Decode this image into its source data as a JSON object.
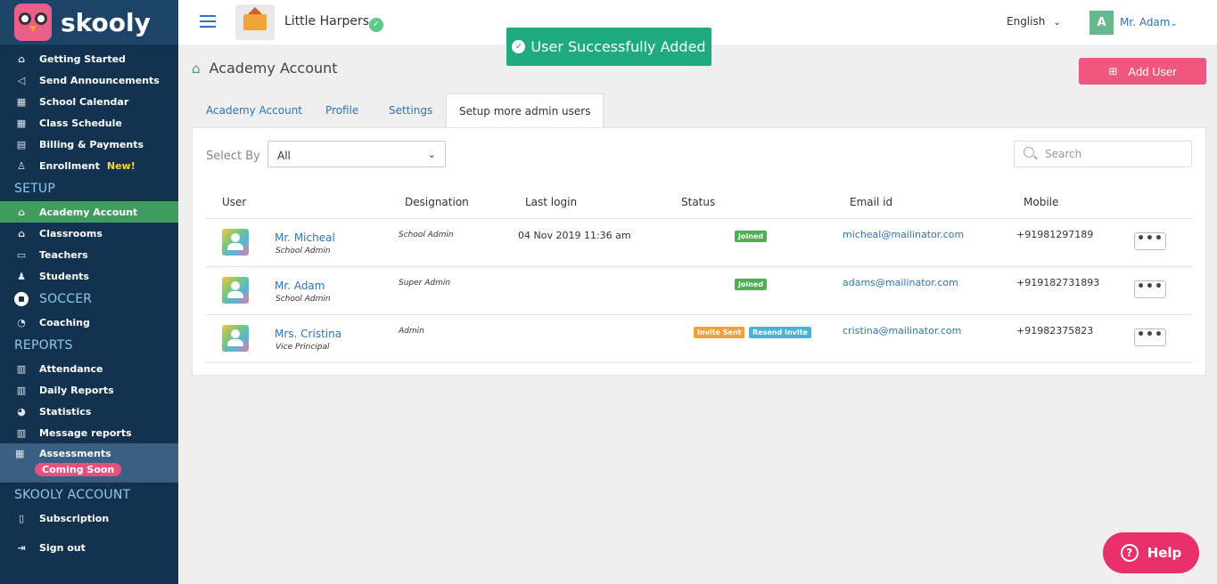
{
  "brand": {
    "name": "skooly"
  },
  "sidebar": {
    "main": [
      {
        "label": "Getting Started",
        "icon": "home-icon"
      },
      {
        "label": "Send Announcements",
        "icon": "megaphone-icon"
      },
      {
        "label": "School Calendar",
        "icon": "calendar-icon"
      },
      {
        "label": "Class Schedule",
        "icon": "schedule-icon"
      },
      {
        "label": "Billing & Payments",
        "icon": "billing-icon"
      },
      {
        "label": "Enrollment",
        "icon": "enrollment-icon",
        "badge": "New!"
      }
    ],
    "setup_title": "SETUP",
    "setup": [
      {
        "label": "Academy Account",
        "icon": "academy-icon",
        "active": true
      },
      {
        "label": "Classrooms",
        "icon": "classroom-icon"
      },
      {
        "label": "Teachers",
        "icon": "teacher-icon"
      },
      {
        "label": "Students",
        "icon": "student-icon"
      }
    ],
    "soccer_title": "SOCCER",
    "soccer": [
      {
        "label": "Coaching",
        "icon": "whistle-icon"
      }
    ],
    "reports_title": "REPORTS",
    "reports": [
      {
        "label": "Attendance",
        "icon": "attendance-icon"
      },
      {
        "label": "Daily Reports",
        "icon": "daily-report-icon"
      },
      {
        "label": "Statistics",
        "icon": "pie-chart-icon"
      },
      {
        "label": "Message reports",
        "icon": "message-report-icon"
      }
    ],
    "assessments": {
      "label": "Assessments",
      "badge": "Coming Soon"
    },
    "account_title": "SKOOLY ACCOUNT",
    "subscription": "Subscription",
    "signout": "Sign out"
  },
  "topbar": {
    "school_name": "Little Harpers",
    "language": "English",
    "user_initial": "A",
    "user_name": "Mr. Adam"
  },
  "toast": "User Successfully Added",
  "page": {
    "title": "Academy Account",
    "add_user": "Add User",
    "tabs": [
      "Academy Account",
      "Profile",
      "Settings",
      "Setup more admin users"
    ],
    "select_by_label": "Select By",
    "select_value": "All",
    "search_placeholder": "Search"
  },
  "table": {
    "headers": [
      "User",
      "Designation",
      "Last login",
      "Status",
      "Email id",
      "Mobile"
    ],
    "rows": [
      {
        "name": "Mr. Micheal",
        "role": "School Admin",
        "designation": "School Admin",
        "last_login": "04 Nov 2019 11:36 am",
        "status": [
          "Joined"
        ],
        "email": "micheal@mailinator.com",
        "mobile": "+91981297189"
      },
      {
        "name": "Mr. Adam",
        "role": "School Admin",
        "designation": "Super Admin",
        "last_login": "",
        "status": [
          "Joined"
        ],
        "email": "adams@mailinator.com",
        "mobile": "+919182731893"
      },
      {
        "name": "Mrs. Cristina",
        "role": "Vice Principal",
        "designation": "Admin",
        "last_login": "",
        "status": [
          "Invite Sent",
          "Resend Invite"
        ],
        "email": "cristina@mailinator.com",
        "mobile": "+91982375823"
      }
    ]
  },
  "help": "Help",
  "colors": {
    "sidebar": "#12324f",
    "active": "#3f9c5e",
    "accent": "#f0577e",
    "toast": "#1faa7f",
    "link": "#2f73b8"
  }
}
